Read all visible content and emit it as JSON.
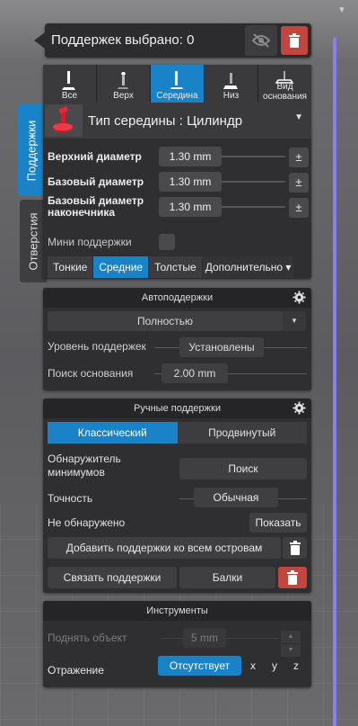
{
  "header": {
    "title": "Поддержек выбрано: 0"
  },
  "vertical_tabs": {
    "supports": "Поддержки",
    "holes": "Отверстия"
  },
  "support_types": [
    {
      "label": "Все",
      "active": false
    },
    {
      "label": "Верх",
      "active": false
    },
    {
      "label": "Середина",
      "active": true
    },
    {
      "label": "Низ",
      "active": false
    },
    {
      "label": "Вид основания",
      "active": false
    }
  ],
  "middle": {
    "title": "Тип середины : Цилиндр",
    "params": [
      {
        "label": "Верхний диаметр",
        "value": "1.30 mm"
      },
      {
        "label": "Базовый диаметр",
        "value": "1.30 mm"
      },
      {
        "label": "Базовый диаметр наконечника",
        "value": "1.30 mm"
      }
    ],
    "pm": "±",
    "mini_supports_label": "Мини поддержки"
  },
  "density_tabs": [
    {
      "label": "Тонкие",
      "active": false
    },
    {
      "label": "Средние",
      "active": true
    },
    {
      "label": "Толстые",
      "active": false
    },
    {
      "label": "Дополнительно ▾",
      "active": false
    }
  ],
  "autosupports": {
    "title": "Автоподдержки",
    "mode_value": "Полностью",
    "level_label": "Уровень поддержек",
    "level_value": "Установлены",
    "base_search_label": "Поиск основания",
    "base_search_value": "2.00 mm"
  },
  "manual": {
    "title": "Ручные поддержки",
    "modes": [
      {
        "label": "Классический",
        "active": true
      },
      {
        "label": "Продвинутый",
        "active": false
      }
    ],
    "detector_label": "Обнаружитель минимумов",
    "detector_button": "Поиск",
    "precision_label": "Точность",
    "precision_value": "Обычная",
    "not_found_label": "Не обнаружено",
    "show_button": "Показать",
    "add_islands_button": "Добавить поддержки ко всем островам",
    "link_button": "Связать поддержки",
    "beams_button": "Балки"
  },
  "tools": {
    "title": "Инструменты",
    "lift_label": "Поднять объект",
    "lift_value": "5 mm",
    "mirror_label": "Отражение",
    "mirror_value": "Отсутствует",
    "axes": [
      "x",
      "y",
      "z"
    ]
  },
  "colors": {
    "accent": "#1a82c6",
    "danger": "#c0463f",
    "panel": "#2f2f31",
    "timeline": "#8a7ef0"
  },
  "icons": [
    "eye-slash-icon",
    "trash-icon",
    "gear-icon",
    "pin-icon",
    "chevron-down-icon"
  ]
}
